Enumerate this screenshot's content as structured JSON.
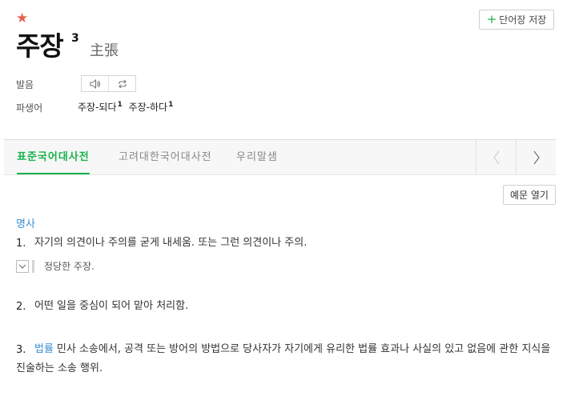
{
  "entry": {
    "star": "★",
    "headword": "주장",
    "homonym_number": "3",
    "hanja": "主張"
  },
  "save_button": {
    "plus": "+",
    "label": "단어장 저장"
  },
  "pronunciation": {
    "label": "발음"
  },
  "derivatives": {
    "label": "파생어",
    "items": [
      {
        "word": "주장-되다",
        "sup": "1"
      },
      {
        "word": "주장-하다",
        "sup": "1"
      }
    ]
  },
  "tabs": [
    {
      "label": "표준국어대사전",
      "active": true
    },
    {
      "label": "고려대한국어대사전",
      "active": false
    },
    {
      "label": "우리말샘",
      "active": false
    }
  ],
  "example_toggle_button": "예문 열기",
  "part_of_speech": "명사",
  "senses": [
    {
      "number": "1.",
      "tag": "",
      "text": "자기의 의견이나 주의를 굳게 내세움. 또는 그런 의견이나 주의.",
      "example": "정당한 주장."
    },
    {
      "number": "2.",
      "tag": "",
      "text": "어떤 일을 중심이 되어 맡아 처리함."
    },
    {
      "number": "3.",
      "tag": "법률",
      "text": "민사 소송에서, 공격 또는 방어의 방법으로 당사자가 자기에게 유리한 법률 효과나 사실의 있고 없음에 관한 지식을 진술하는 소송 행위."
    }
  ],
  "colors": {
    "accent_green": "#19b24b",
    "link_blue": "#3d8fd3",
    "star_red": "#e8604c"
  },
  "icons": [
    "plus-icon",
    "speaker-icon",
    "repeat-icon",
    "chevron-left-icon",
    "chevron-right-icon",
    "chevron-down-icon"
  ]
}
